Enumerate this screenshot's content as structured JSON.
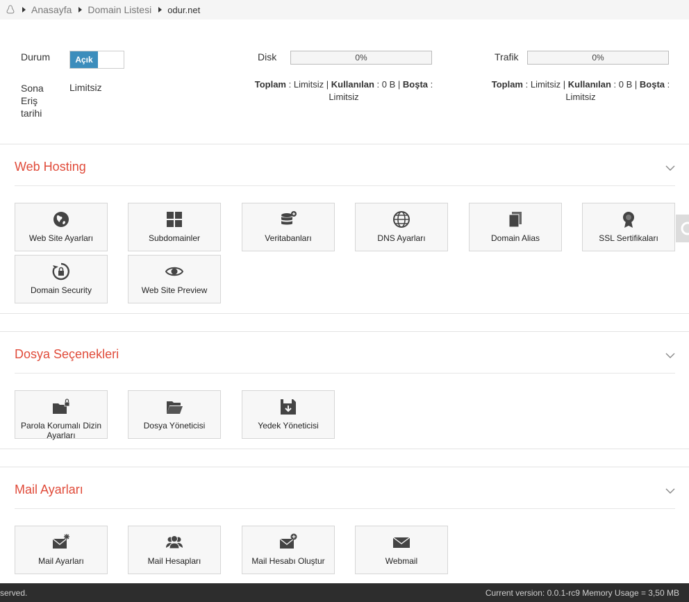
{
  "breadcrumb": {
    "home_icon": "linux-penguin-icon",
    "items": [
      "Anasayfa",
      "Domain Listesi",
      "odur.net"
    ]
  },
  "status": {
    "durum_label": "Durum",
    "toggle_on_label": "Açık",
    "expiry_label_lines": [
      "Sona",
      "Eriş",
      "tarihi"
    ],
    "expiry_value": "Limitsiz"
  },
  "disk": {
    "label": "Disk",
    "percent_text": "0%",
    "percent_value": 0,
    "toplam_label": "Toplam",
    "toplam_value": "Limitsiz",
    "kullanilan_label": "Kullanılan",
    "kullanilan_value": "0 B",
    "bosta_label": "Boşta",
    "bosta_value": "Limitsiz"
  },
  "trafik": {
    "label": "Trafik",
    "percent_text": "0%",
    "percent_value": 0,
    "toplam_label": "Toplam",
    "toplam_value": "Limitsiz",
    "kullanilan_label": "Kullanılan",
    "kullanilan_value": "0 B",
    "bosta_label": "Boşta",
    "bosta_value": "Limitsiz"
  },
  "panels": {
    "web_hosting": {
      "title": "Web Hosting",
      "tiles": [
        {
          "label": "Web Site Ayarları",
          "icon": "globe-icon"
        },
        {
          "label": "Subdomainler",
          "icon": "grid-icon"
        },
        {
          "label": "Veritabanları",
          "icon": "database-plus-icon"
        },
        {
          "label": "DNS Ayarları",
          "icon": "world-icon"
        },
        {
          "label": "Domain Alias",
          "icon": "copy-icon"
        },
        {
          "label": "SSL Sertifikaları",
          "icon": "certificate-icon"
        },
        {
          "label": "Domain Security",
          "icon": "lock-refresh-icon"
        },
        {
          "label": "Web Site Preview",
          "icon": "eye-icon"
        }
      ]
    },
    "dosya": {
      "title": "Dosya Seçenekleri",
      "tiles": [
        {
          "label": "Parola Korumalı Dizin Ayarları",
          "icon": "folder-lock-icon"
        },
        {
          "label": "Dosya Yöneticisi",
          "icon": "folder-open-icon"
        },
        {
          "label": "Yedek Yöneticisi",
          "icon": "floppy-download-icon"
        }
      ]
    },
    "mail": {
      "title": "Mail Ayarları",
      "tiles": [
        {
          "label": "Mail Ayarları",
          "icon": "envelope-gear-icon"
        },
        {
          "label": "Mail Hesapları",
          "icon": "users-icon"
        },
        {
          "label": "Mail Hesabı Oluştur",
          "icon": "envelope-plus-icon"
        },
        {
          "label": "Webmail",
          "icon": "envelope-icon"
        }
      ]
    }
  },
  "footer": {
    "left_text": "served.",
    "right_text": "Current version: 0.0.1-rc9 Memory Usage = 3,50 MB"
  },
  "colors": {
    "accent_red": "#e04b3a",
    "toggle_blue": "#3c8dbc",
    "footer_bg": "#2d2d2d"
  }
}
